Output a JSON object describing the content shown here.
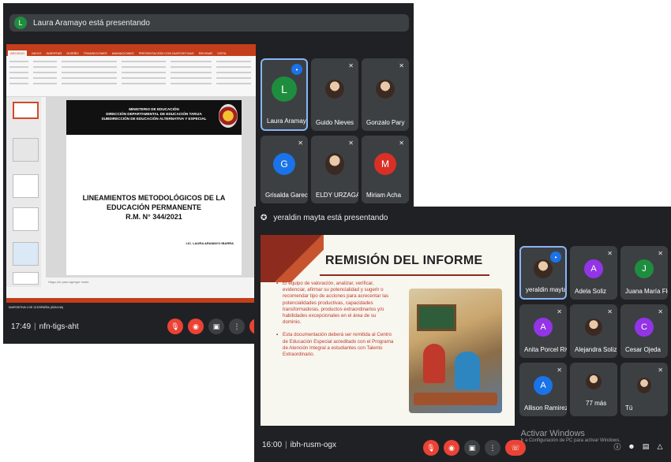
{
  "meet1": {
    "presenter_initial": "L",
    "presenter_banner": "Laura Aramayo está presentando",
    "meeting_time": "17:49",
    "meeting_code": "nfn-tigs-aht",
    "participants": [
      {
        "name": "Laura Aramayo",
        "initial": "L",
        "color": "#1e8e3e"
      },
      {
        "name": "Guido Nieves"
      },
      {
        "name": "Gonzalo Pary"
      },
      {
        "name": "Grisalda Gareca",
        "initial": "G",
        "color": "#1a73e8"
      },
      {
        "name": "ELDY URZAGASTE"
      },
      {
        "name": "Miriam Acha",
        "initial": "M",
        "color": "#d93025"
      }
    ],
    "slide": {
      "header_lines": [
        "MINISTERIO DE EDUCACIÓN",
        "DIRECCIÓN DEPARTAMENTAL DE EDUCACIÓN TARIJA",
        "SUBDIRECCIÓN DE EDUCACIÓN ALTERNATIVA Y ESPECIAL"
      ],
      "title_lines": [
        "LINEAMIENTOS METODOLÓGICOS DE LA",
        "EDUCACIÓN PERMANENTE",
        "R.M. N° 344/2021"
      ],
      "signature": "LIC. LAURA ARAMAYO IBARRA"
    },
    "ppt": {
      "tabs": [
        "ARCHIVO",
        "INICIO",
        "INSERTAR",
        "DISEÑO",
        "TRANSICIONES",
        "ANIMACIONES",
        "PRESENTACIÓN CON DIAPOSITIVAS",
        "REVISAR",
        "VISTA"
      ],
      "notes_placeholder": "Haga clic para agregar notas",
      "status": "DIAPOSITIVA 1 DE 13   ESPAÑOL (BOLIVIA)"
    }
  },
  "meet2": {
    "presenter_banner": "yeraldin mayta está presentando",
    "meeting_time": "16:00",
    "meeting_code": "ibh-rusm-ogx",
    "slide": {
      "title": "REMISIÓN DEL INFORME",
      "bullets": [
        "El equipo de valoración, analizar, verificar, evidenciar, afirmar su potencialidad y sugerir o recomendar tipo de acciones para acrecentar las potencialidades productivas, capacidades transformadoras, productos extraordinarios y/o habilidades excepcionales en el área de su dominio.",
        "Esta documentación deberá ser remitida al Centro de Educación Especial acreditado con el Programa de Atención Integral a estudiantes con Talento Extraordinario."
      ]
    },
    "participants": [
      {
        "name": "yeraldin mayta"
      },
      {
        "name": "Adela Soliz",
        "initial": "A",
        "color": "#9334e6"
      },
      {
        "name": "Juana María Flores",
        "initial": "J",
        "color": "#1e8e3e"
      },
      {
        "name": "Anita Porcel Rivera",
        "initial": "A",
        "color": "#9334e6"
      },
      {
        "name": "Alejandra Soliz Ju..."
      },
      {
        "name": "Cesar Ojeda",
        "initial": "C",
        "color": "#9334e6"
      },
      {
        "name": "Allison Ramirez Es...",
        "initial": "A",
        "color": "#1a73e8"
      },
      {
        "name": "77 más"
      },
      {
        "name": "Tú"
      }
    ],
    "watermark_title": "Activar Windows",
    "watermark_sub": "Ir a Configuración de PC para activar Windows."
  }
}
